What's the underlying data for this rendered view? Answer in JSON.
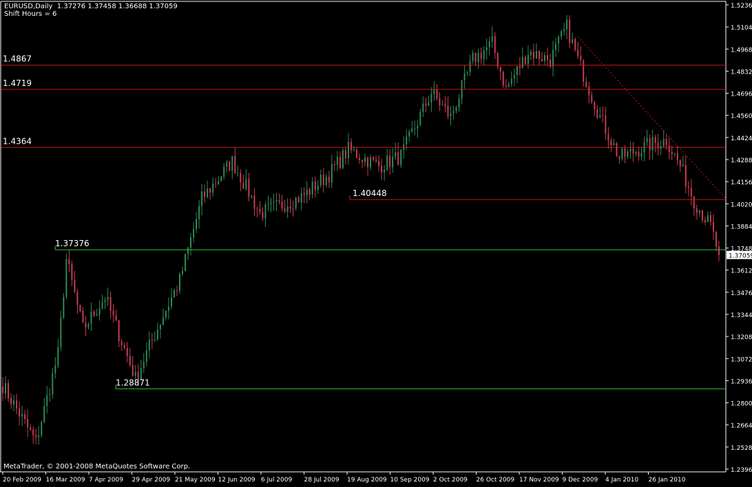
{
  "header": {
    "symbol_line": "EURUSD,Daily  1.37276 1.37458 1.36688 1.37059",
    "shift_line": "Shift Hours = 6"
  },
  "footer": {
    "copyright": "MetaTrader, © 2001-2008 MetaQuotes Software Corp."
  },
  "colors": {
    "background": "#000000",
    "axis": "#ffffff",
    "bull_candle": "#2e8b57",
    "bear_candle": "#cd3b53",
    "resistance_line": "#d01818",
    "support_line": "#2ecc2e",
    "price_tag_bg": "#ffffff",
    "price_tag_text": "#000000"
  },
  "chart_data": {
    "type": "candlestick",
    "symbol": "EURUSD",
    "timeframe": "Daily",
    "ylim": [
      1.23955,
      1.5244
    ],
    "y_ticks": [
      "1.52360",
      "1.51040",
      "1.49680",
      "1.48320",
      "1.46960",
      "1.45600",
      "1.44240",
      "1.42880",
      "1.41560",
      "1.40200",
      "1.38840",
      "1.37480",
      "1.36120",
      "1.34760",
      "1.33440",
      "1.32080",
      "1.30720",
      "1.29360",
      "1.28000",
      "1.26640",
      "1.25280",
      "1.23960"
    ],
    "x_ticks": [
      "20 Feb 2009",
      "16 Mar 2009",
      "7 Apr 2009",
      "29 Apr 2009",
      "21 May 2009",
      "12 Jun 2009",
      "6 Jul 2009",
      "28 Jul 2009",
      "19 Aug 2009",
      "10 Sep 2009",
      "2 Oct 2009",
      "26 Oct 2009",
      "17 Nov 2009",
      "9 Dec 2009",
      "4 Jan 2010",
      "26 Jan 2010"
    ],
    "current_price": "1.37059",
    "anchors": [
      {
        "bar": 0,
        "price": 1.291
      },
      {
        "bar": 12,
        "price": 1.256
      },
      {
        "bar": 20,
        "price": 1.31
      },
      {
        "bar": 23,
        "price": 1.368
      },
      {
        "bar": 29,
        "price": 1.325
      },
      {
        "bar": 37,
        "price": 1.345
      },
      {
        "bar": 48,
        "price": 1.295
      },
      {
        "bar": 57,
        "price": 1.33
      },
      {
        "bar": 64,
        "price": 1.355
      },
      {
        "bar": 72,
        "price": 1.405
      },
      {
        "bar": 83,
        "price": 1.428
      },
      {
        "bar": 93,
        "price": 1.396
      },
      {
        "bar": 108,
        "price": 1.406
      },
      {
        "bar": 118,
        "price": 1.42
      },
      {
        "bar": 125,
        "price": 1.435
      },
      {
        "bar": 136,
        "price": 1.425
      },
      {
        "bar": 144,
        "price": 1.431
      },
      {
        "bar": 155,
        "price": 1.47
      },
      {
        "bar": 162,
        "price": 1.455
      },
      {
        "bar": 170,
        "price": 1.49
      },
      {
        "bar": 177,
        "price": 1.5
      },
      {
        "bar": 182,
        "price": 1.472
      },
      {
        "bar": 190,
        "price": 1.495
      },
      {
        "bar": 198,
        "price": 1.49
      },
      {
        "bar": 204,
        "price": 1.51
      },
      {
        "bar": 208,
        "price": 1.49
      },
      {
        "bar": 216,
        "price": 1.455
      },
      {
        "bar": 223,
        "price": 1.43
      },
      {
        "bar": 234,
        "price": 1.438
      },
      {
        "bar": 240,
        "price": 1.441
      },
      {
        "bar": 245,
        "price": 1.425
      },
      {
        "bar": 250,
        "price": 1.404
      },
      {
        "bar": 256,
        "price": 1.388
      },
      {
        "bar": 259,
        "price": 1.3706
      }
    ],
    "horizontal_lines": [
      {
        "price": 1.4867,
        "label": "1.4867",
        "color": "red"
      },
      {
        "price": 1.4719,
        "label": "1.4719",
        "color": "red"
      },
      {
        "price": 1.4364,
        "label": "1.4364",
        "color": "red"
      },
      {
        "price": 1.40448,
        "label": "1.40448",
        "color": "red"
      },
      {
        "price": 1.37376,
        "label": "1.37376",
        "color": "green"
      },
      {
        "price": 1.28871,
        "label": "1.28871",
        "color": "green"
      }
    ],
    "trendline": {
      "from_price": 1.504,
      "to_price": 1.405,
      "style": "dotted",
      "color": "red"
    }
  }
}
